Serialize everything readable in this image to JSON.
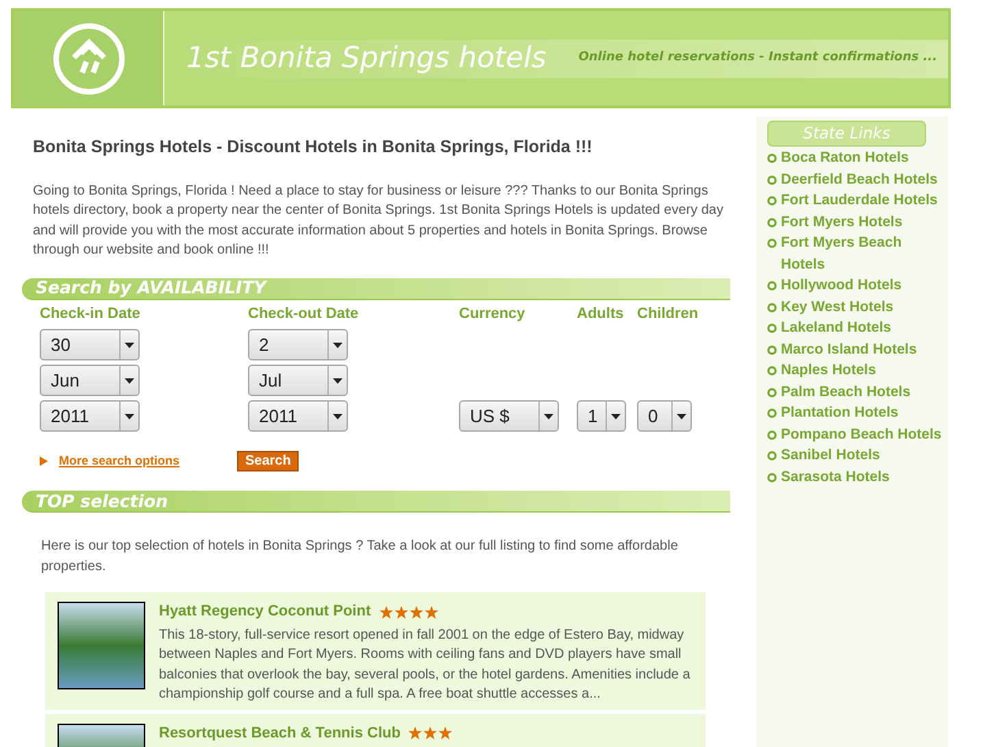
{
  "header": {
    "title": "1st Bonita Springs hotels",
    "tagline": "Online hotel reservations - Instant confirmations ..."
  },
  "heading": "Bonita Springs Hotels - Discount Hotels in Bonita Springs, Florida !!!",
  "intro": "Going to Bonita Springs, Florida ! Need a place to stay for business or leisure ??? Thanks to our Bonita Springs hotels directory, book a property near the center of Bonita Springs. 1st Bonita Springs Hotels is updated every day and will provide you with the most accurate information about 5 properties and hotels in Bonita Springs. Browse through our website and book online !!!",
  "search": {
    "title": "Search by AVAILABILITY",
    "checkin": {
      "label": "Check-in Date",
      "day": "30",
      "month": "Jun",
      "year": "2011"
    },
    "checkout": {
      "label": "Check-out Date",
      "day": "2",
      "month": "Jul",
      "year": "2011"
    },
    "currency": {
      "label": "Currency",
      "value": "US $"
    },
    "adults": {
      "label": "Adults",
      "value": "1"
    },
    "children": {
      "label": "Children",
      "value": "0"
    },
    "more_link": "More search options",
    "button": "Search"
  },
  "top": {
    "title": "TOP selection",
    "text": "Here is our top selection of hotels in Bonita Springs ? Take a look at our full listing to find some affordable properties.",
    "hotels": [
      {
        "name": "Hyatt Regency Coconut Point",
        "stars": 4,
        "description": "This 18-story, full-service resort opened in fall 2001 on the edge of Estero Bay, midway between Naples and Fort Myers. Rooms with ceiling fans and DVD players have small balconies that overlook the bay, several pools, or the hotel gardens. Amenities include a championship golf course and a full spa. A free boat shuttle accesses a..."
      },
      {
        "name": "Resortquest Beach & Tennis Club",
        "stars": 3
      }
    ]
  },
  "sidebar": {
    "title": "State Links",
    "links": [
      "Boca Raton Hotels",
      "Deerfield Beach Hotels",
      "Fort Lauderdale Hotels",
      "Fort Myers Hotels",
      "Fort Myers Beach Hotels",
      "Hollywood Hotels",
      "Key West Hotels",
      "Lakeland Hotels",
      "Marco Island Hotels",
      "Naples Hotels",
      "Palm Beach Hotels",
      "Plantation Hotels",
      "Pompano Beach Hotels",
      "Sanibel Hotels",
      "Sarasota Hotels"
    ]
  }
}
